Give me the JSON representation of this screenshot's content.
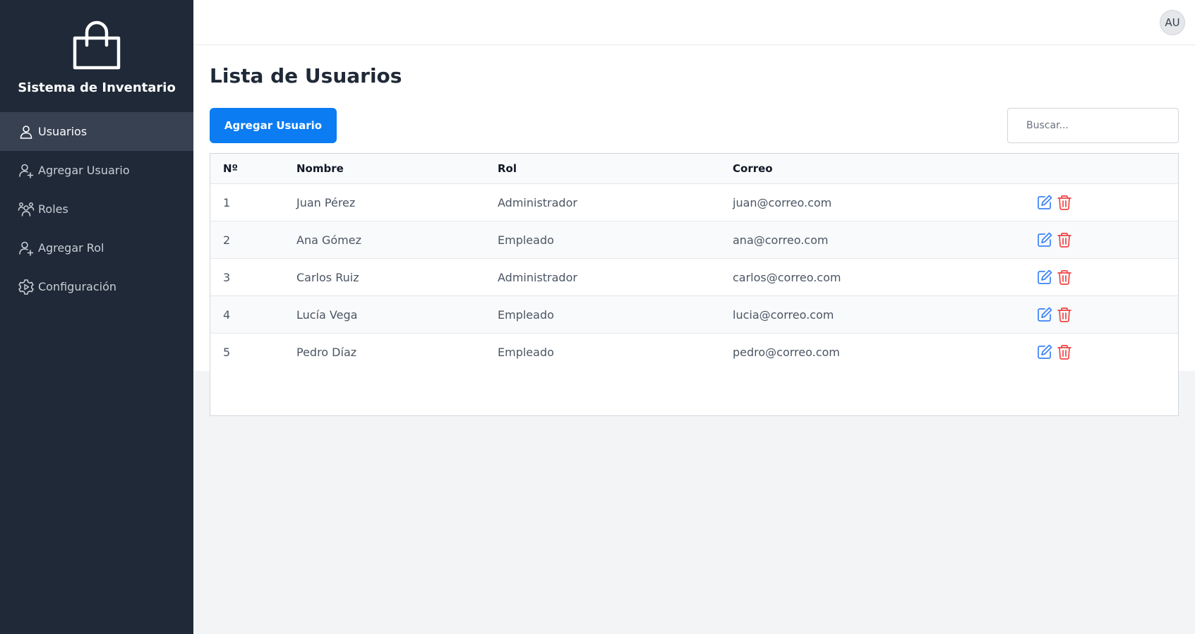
{
  "sidebar": {
    "title": "Sistema de Inventario",
    "items": [
      {
        "label": "Usuarios",
        "icon": "user-icon",
        "active": true
      },
      {
        "label": "Agregar Usuario",
        "icon": "user-plus-icon",
        "active": false
      },
      {
        "label": "Roles",
        "icon": "users-group-icon",
        "active": false
      },
      {
        "label": "Agregar Rol",
        "icon": "user-plus-icon",
        "active": false
      },
      {
        "label": "Configuración",
        "icon": "gear-icon",
        "active": false
      }
    ]
  },
  "topbar": {
    "avatar_initials": "AU"
  },
  "main": {
    "title": "Lista de Usuarios",
    "add_button_label": "Agregar Usuario",
    "search_placeholder": "Buscar...",
    "columns": [
      "Nº",
      "Nombre",
      "Rol",
      "Correo"
    ],
    "rows": [
      {
        "num": "1",
        "nombre": "Juan Pérez",
        "rol": "Administrador",
        "correo": "juan@correo.com"
      },
      {
        "num": "2",
        "nombre": "Ana Gómez",
        "rol": "Empleado",
        "correo": "ana@correo.com"
      },
      {
        "num": "3",
        "nombre": "Carlos Ruiz",
        "rol": "Administrador",
        "correo": "carlos@correo.com"
      },
      {
        "num": "4",
        "nombre": "Lucía Vega",
        "rol": "Empleado",
        "correo": "lucia@correo.com"
      },
      {
        "num": "5",
        "nombre": "Pedro Díaz",
        "rol": "Empleado",
        "correo": "pedro@correo.com"
      }
    ],
    "row_actions": [
      {
        "name": "edit-icon",
        "color": "#3b82f6"
      },
      {
        "name": "trash-icon",
        "color": "#ef4444"
      }
    ]
  },
  "colors": {
    "sidebar_bg": "#1f2937",
    "sidebar_active_bg": "#374151",
    "primary": "#0b7cf2",
    "edit": "#3b82f6",
    "delete": "#ef4444"
  }
}
